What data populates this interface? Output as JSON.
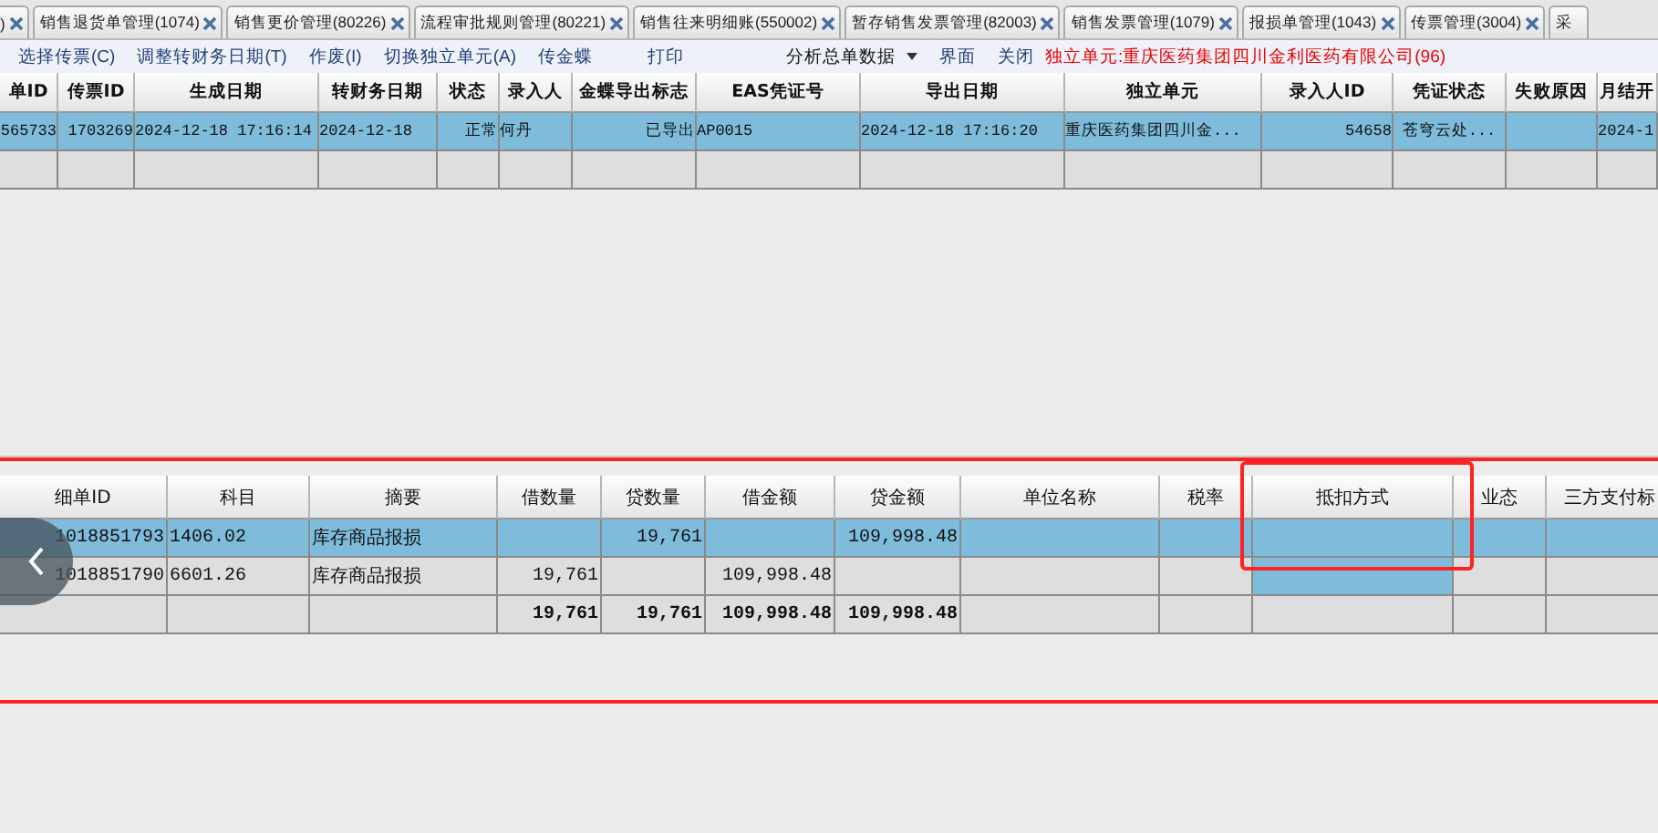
{
  "tabs": [
    {
      "label": ")",
      "selected": false
    },
    {
      "label": "销售退货单管理(1074)",
      "selected": false
    },
    {
      "label": "销售更价管理(80226)",
      "selected": false
    },
    {
      "label": "流程审批规则管理(80221)",
      "selected": false
    },
    {
      "label": "销售往来明细账(550002)",
      "selected": false
    },
    {
      "label": "暂存销售发票管理(82003)",
      "selected": false
    },
    {
      "label": "销售发票管理(1079)",
      "selected": false
    },
    {
      "label": "报损单管理(1043)",
      "selected": false
    },
    {
      "label": "传票管理(3004)",
      "selected": false
    },
    {
      "label": "采",
      "selected": false,
      "cut": true
    }
  ],
  "toolbar": [
    {
      "kind": "button",
      "label": "选择传票(C)"
    },
    {
      "kind": "button",
      "label": "调整转财务日期(T)"
    },
    {
      "kind": "button",
      "label": "作废(I)"
    },
    {
      "kind": "button",
      "label": "切换独立单元(A)"
    },
    {
      "kind": "button",
      "label": "传金蝶"
    },
    {
      "kind": "button",
      "label": "打印"
    },
    {
      "kind": "dropdown",
      "label": "分析总单数据"
    },
    {
      "kind": "button",
      "label": "界面"
    },
    {
      "kind": "button",
      "label": "关闭"
    },
    {
      "kind": "notice",
      "label": "独立单元:重庆医药集团四川金利医药有限公司(96)"
    }
  ],
  "master_table": {
    "columns": [
      "单ID",
      "传票ID",
      "生成日期",
      "转财务日期",
      "状态",
      "录入人",
      "金蝶导出标志",
      "EAS凭证号",
      "导出日期",
      "独立单元",
      "录入人ID",
      "凭证状态",
      "失败原因",
      "月结开"
    ],
    "rows": [
      {
        "selected": true,
        "cells": [
          "565733",
          "1703269",
          "2024-12-18 17:16:14",
          "2024-12-18",
          "正常",
          "何丹",
          "已导出",
          "AP0015",
          "2024-12-18 17:16:20",
          "重庆医药集团四川金...",
          "54658",
          "苍穹云处...",
          null,
          "2024-1"
        ]
      },
      {
        "selected": false
      }
    ]
  },
  "detail_table": {
    "columns": [
      "细单ID",
      "科目",
      "摘要",
      "借数量",
      "贷数量",
      "借金额",
      "贷金额",
      "单位名称",
      "税率",
      "抵扣方式",
      "业态",
      "三方支付标"
    ],
    "rows": [
      {
        "kind": "data",
        "cells": [
          {
            "text": "1018851793",
            "selected": true
          },
          {
            "text": "1406.02",
            "selected": true
          },
          {
            "text": "库存商品报损",
            "selected": true
          },
          {
            "selected": true
          },
          {
            "text": "19,761",
            "selected": true
          },
          {
            "selected": true
          },
          {
            "text": "109,998.48",
            "selected": true
          },
          {
            "selected": true
          },
          {
            "selected": true
          },
          {
            "selected": true
          },
          {
            "selected": true
          },
          {
            "selected": true
          }
        ]
      },
      {
        "kind": "data",
        "cells": [
          {
            "text": "1018851790",
            "selected": false
          },
          {
            "text": "6601.26",
            "selected": false
          },
          {
            "text": "库存商品报损",
            "selected": false
          },
          {
            "text": "19,761",
            "selected": false
          },
          {
            "selected": false
          },
          {
            "text": "109,998.48",
            "selected": false
          },
          {
            "selected": false
          },
          {
            "selected": false
          },
          {
            "selected": false
          },
          {
            "selected": true
          },
          {
            "selected": false
          },
          {
            "selected": false
          }
        ]
      },
      {
        "kind": "total",
        "cells": [
          {
            "selected": false
          },
          {
            "selected": false
          },
          {
            "selected": false
          },
          {
            "text": "19,761",
            "selected": false
          },
          {
            "text": "19,761",
            "selected": false
          },
          {
            "text": "109,998.48",
            "selected": false
          },
          {
            "text": "109,998.48",
            "selected": false
          },
          {
            "selected": false
          },
          {
            "selected": false
          },
          {
            "selected": false
          },
          {
            "selected": false
          },
          {
            "selected": false
          }
        ]
      }
    ]
  }
}
